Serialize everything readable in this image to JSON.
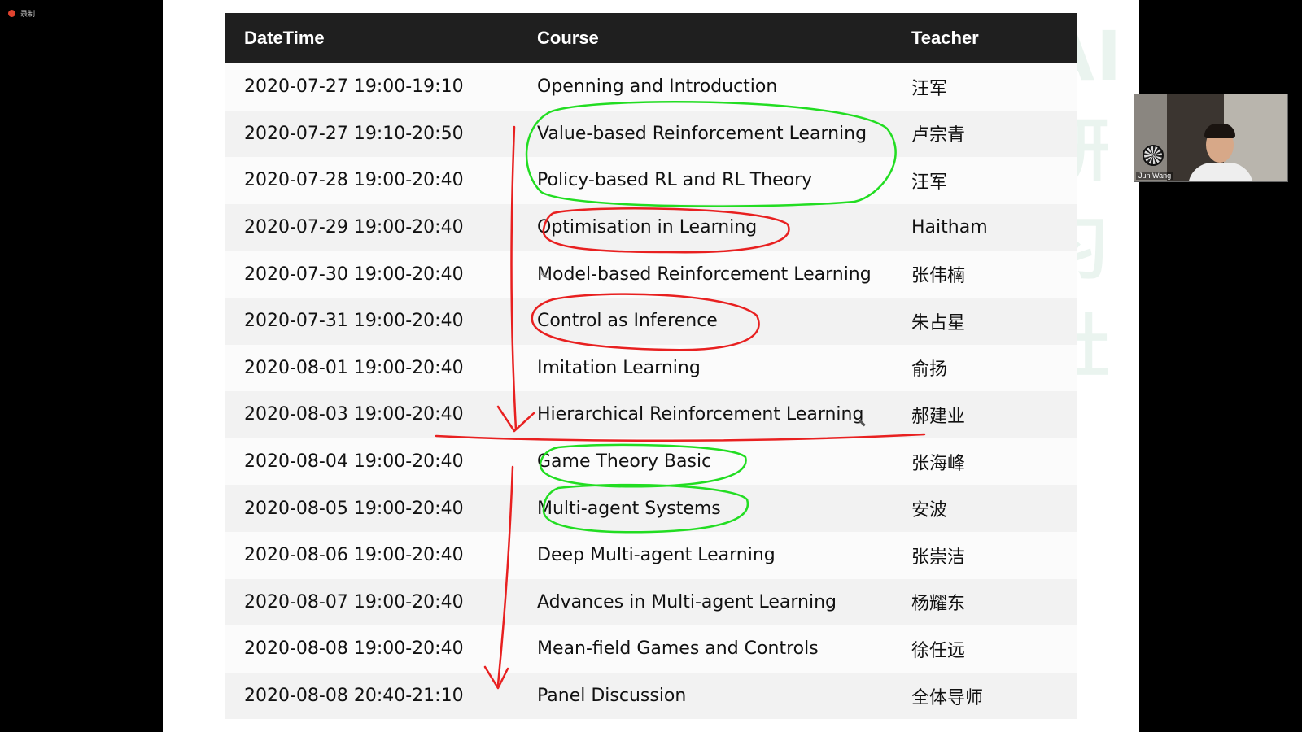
{
  "recording": {
    "label": "录制"
  },
  "slide": {
    "watermark": "AI研习社",
    "headers": {
      "datetime": "DateTime",
      "course": "Course",
      "teacher": "Teacher"
    },
    "rows": [
      {
        "datetime": "2020-07-27 19:00-19:10",
        "course": "Openning and Introduction",
        "teacher": "汪军"
      },
      {
        "datetime": "2020-07-27 19:10-20:50",
        "course": "Value-based Reinforcement Learning",
        "teacher": "卢宗青"
      },
      {
        "datetime": "2020-07-28 19:00-20:40",
        "course": "Policy-based RL and RL Theory",
        "teacher": "汪军"
      },
      {
        "datetime": "2020-07-29 19:00-20:40",
        "course": "Optimisation in Learning",
        "teacher": "Haitham"
      },
      {
        "datetime": "2020-07-30 19:00-20:40",
        "course": "Model-based Reinforcement Learning",
        "teacher": "张伟楠"
      },
      {
        "datetime": "2020-07-31 19:00-20:40",
        "course": "Control as Inference",
        "teacher": "朱占星"
      },
      {
        "datetime": "2020-08-01 19:00-20:40",
        "course": "Imitation Learning",
        "teacher": "俞扬"
      },
      {
        "datetime": "2020-08-03 19:00-20:40",
        "course": "Hierarchical Reinforcement Learning",
        "teacher": "郝建业"
      },
      {
        "datetime": "2020-08-04 19:00-20:40",
        "course": "Game Theory Basic",
        "teacher": "张海峰"
      },
      {
        "datetime": "2020-08-05 19:00-20:40",
        "course": "Multi-agent Systems",
        "teacher": "安波"
      },
      {
        "datetime": "2020-08-06 19:00-20:40",
        "course": "Deep Multi-agent Learning",
        "teacher": "张崇洁"
      },
      {
        "datetime": "2020-08-07 19:00-20:40",
        "course": "Advances in Multi-agent Learning",
        "teacher": "杨耀东"
      },
      {
        "datetime": "2020-08-08 19:00-20:40",
        "course": "Mean-field Games and Controls",
        "teacher": "徐任远"
      },
      {
        "datetime": "2020-08-08 20:40-21:10",
        "course": "Panel Discussion",
        "teacher": "全体导师"
      }
    ]
  },
  "annotations": {
    "green_color": "#22dd22",
    "red_color": "#e82020"
  },
  "webcam": {
    "name": "Jun Wang"
  }
}
